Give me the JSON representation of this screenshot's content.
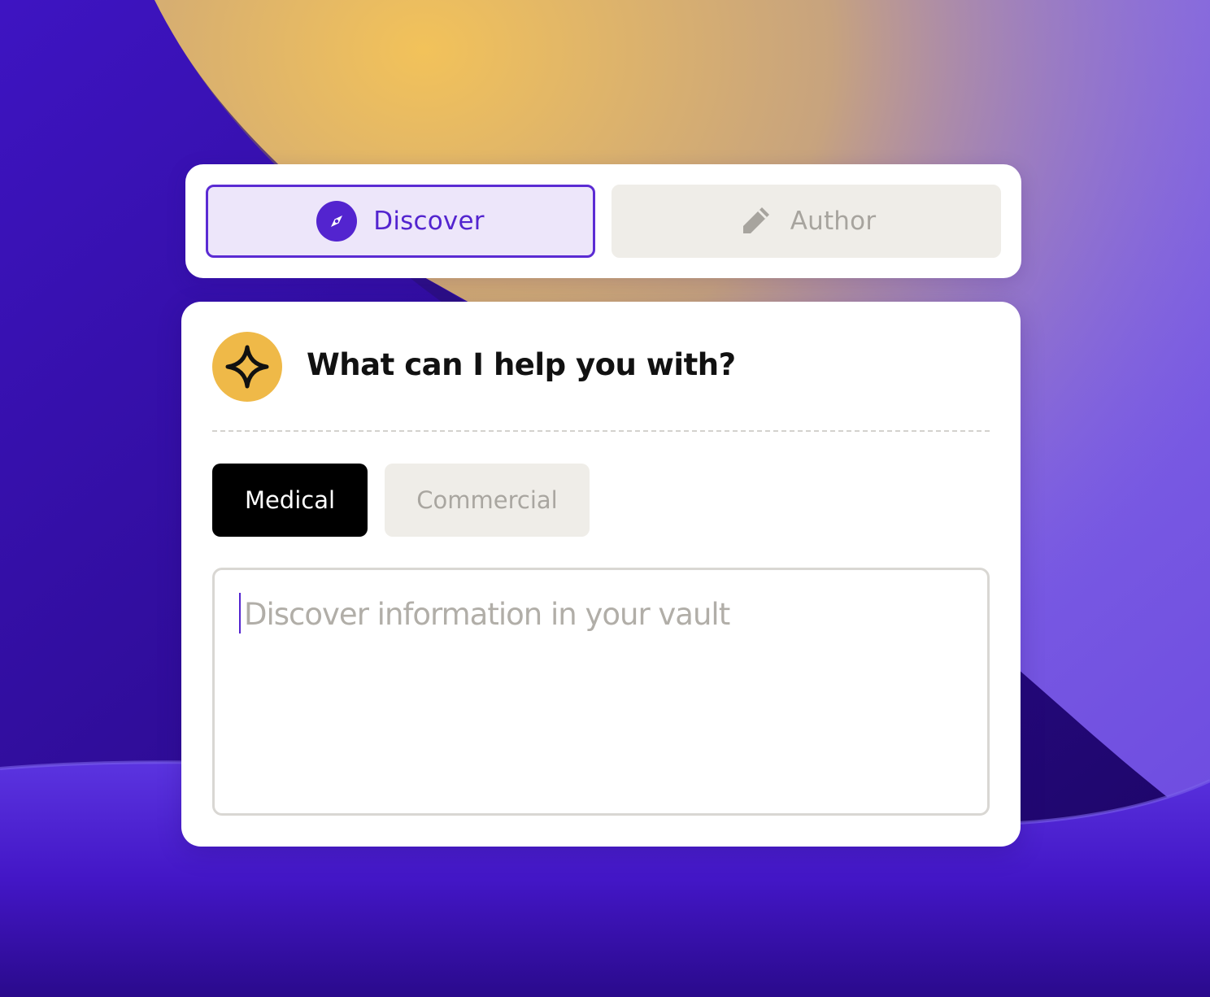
{
  "colors": {
    "accent": "#5324cf",
    "accent_light": "#ede6fa",
    "neutral_chip": "#efede8",
    "avatar": "#efb948",
    "dark_chip": "#000000"
  },
  "modes": {
    "discover": {
      "label": "Discover",
      "icon": "compass-icon",
      "selected": true
    },
    "author": {
      "label": "Author",
      "icon": "pencil-icon",
      "selected": false
    }
  },
  "assistant": {
    "icon": "sparkle-icon",
    "prompt": "What can I help you with?"
  },
  "categories": [
    {
      "label": "Medical",
      "selected": true
    },
    {
      "label": "Commercial",
      "selected": false
    }
  ],
  "query": {
    "value": "",
    "placeholder": "Discover information in your vault"
  }
}
